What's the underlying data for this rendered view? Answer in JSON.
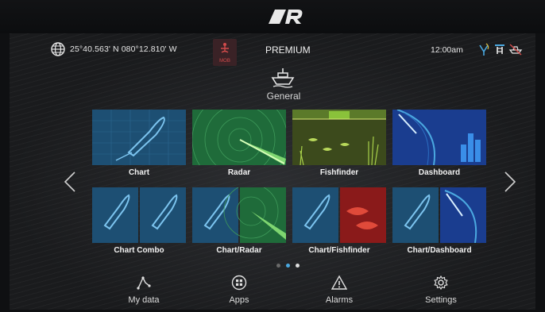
{
  "status": {
    "coordinates": "25°40.563' N  080°12.810' W",
    "mob_label": "MOB",
    "edition": "PREMIUM",
    "time": "12:00am"
  },
  "mode": {
    "icon": "boat-icon",
    "label": "General"
  },
  "apps_row1": [
    {
      "label": "Chart",
      "icon": "chart-app-icon"
    },
    {
      "label": "Radar",
      "icon": "radar-app-icon"
    },
    {
      "label": "Fishfinder",
      "icon": "fishfinder-app-icon"
    },
    {
      "label": "Dashboard",
      "icon": "dashboard-app-icon"
    }
  ],
  "apps_row2": [
    {
      "label": "Chart Combo",
      "icon": "chart-combo-app-icon"
    },
    {
      "label": "Chart/Radar",
      "icon": "chart-radar-app-icon"
    },
    {
      "label": "Chart/Fishfinder",
      "icon": "chart-fishfinder-app-icon"
    },
    {
      "label": "Chart/Dashboard",
      "icon": "chart-dashboard-app-icon"
    }
  ],
  "pagination": {
    "pages": 3,
    "current": 2
  },
  "dock": [
    {
      "label": "My data",
      "icon": "my-data-icon"
    },
    {
      "label": "Apps",
      "icon": "apps-icon"
    },
    {
      "label": "Alarms",
      "icon": "alarm-icon"
    },
    {
      "label": "Settings",
      "icon": "gear-icon"
    }
  ],
  "colors": {
    "chart_blue": "#1d4f73",
    "radar_green": "#1f6b3a",
    "fishfinder_green": "#5b7a2a",
    "dashboard_blue": "#1a3d8f",
    "alert_red": "#c0302a",
    "accent_blue": "#4aa8e0"
  }
}
